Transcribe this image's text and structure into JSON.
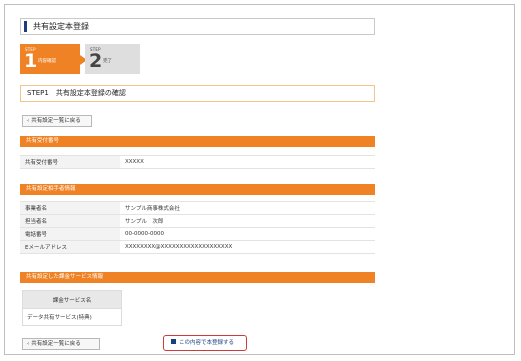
{
  "page": {
    "title": "共有設定本登録"
  },
  "steps": [
    {
      "word": "STEP",
      "number": "1",
      "label": "内容確認",
      "active": true
    },
    {
      "word": "STEP",
      "number": "2",
      "label": "完了",
      "active": false
    }
  ],
  "step_heading": "STEP1　共有設定本登録の確認",
  "back_button": {
    "label": "共有設定一覧に戻る"
  },
  "sections": {
    "acceptance": {
      "title": "共有受付番号",
      "rows": [
        {
          "label": "共有受付番号",
          "value": "XXXXX"
        }
      ]
    },
    "partner": {
      "title": "共有設定相手者情報",
      "rows": [
        {
          "label": "事業者名",
          "value": "サンプル商事株式会社"
        },
        {
          "label": "担当者名",
          "value": "サンプル　次郎"
        },
        {
          "label": "電話番号",
          "value": "00-0000-0000"
        },
        {
          "label": "Eメールアドレス",
          "value": "XXXXXXXX@XXXXXXXXXXXXXXXXXXX"
        }
      ]
    },
    "billing": {
      "title": "共有設定した課金サービス情報",
      "column_header": "課金サービス名",
      "rows": [
        "データ共有サービス(特典)"
      ]
    }
  },
  "register_button": {
    "label": "この内容で本登録する"
  },
  "colors": {
    "accent": "#ef8224",
    "title_accent": "#1f3d7a",
    "register_border": "#cf3b3b"
  }
}
